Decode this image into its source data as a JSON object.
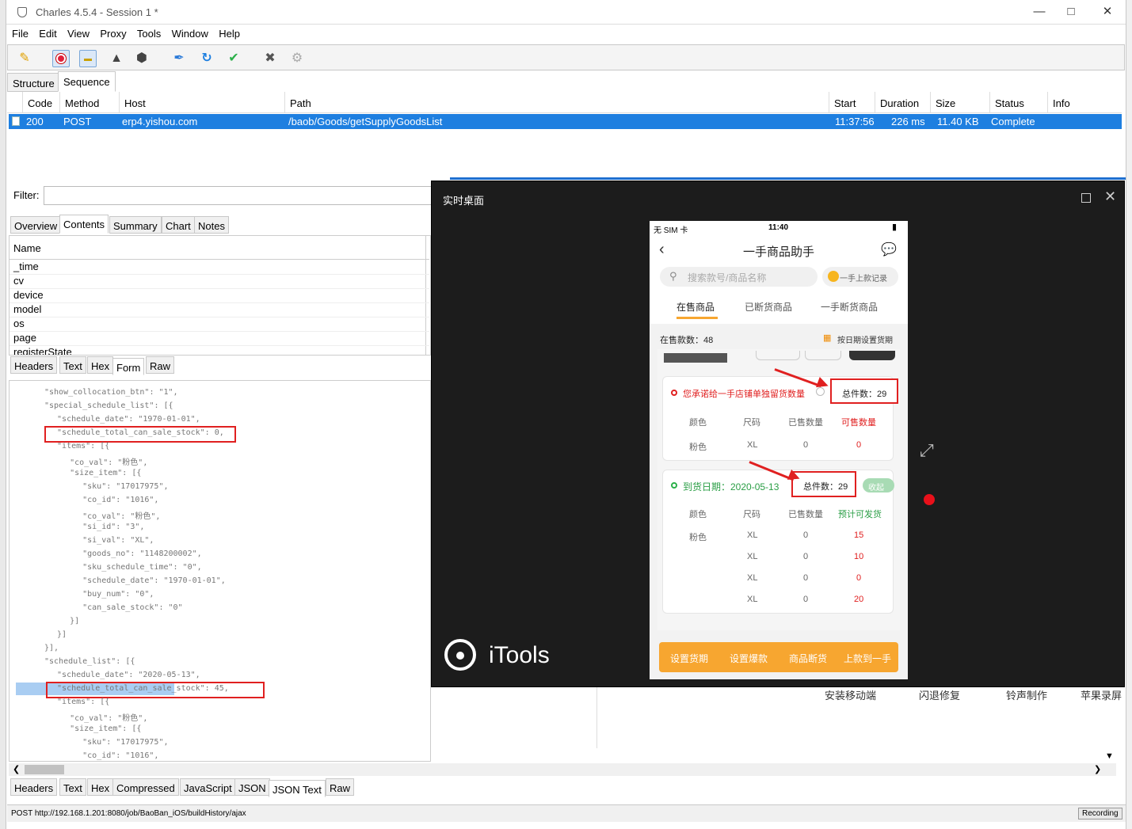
{
  "window": {
    "title": "Charles 4.5.4 - Session 1 *",
    "minimize": "—",
    "maximize": "□",
    "close": "✕"
  },
  "menu": [
    "File",
    "Edit",
    "View",
    "Proxy",
    "Tools",
    "Window",
    "Help"
  ],
  "toolbar": [
    "broom-icon",
    "record-icon",
    "throttle-icon",
    "turtle-icon",
    "stop-icon",
    "pen-icon",
    "refresh-icon",
    "check-icon",
    "tools-icon",
    "settings-icon"
  ],
  "tabs": {
    "structure": "Structure",
    "sequence": "Sequence"
  },
  "sequence": {
    "columns": [
      "Code",
      "Method",
      "Host",
      "Path",
      "Start",
      "Duration",
      "Size",
      "Status",
      "Info"
    ],
    "row": {
      "code": "200",
      "method": "POST",
      "host": "erp4.yishou.com",
      "path": "/baob/Goods/getSupplyGoodsList",
      "start": "11:37:56",
      "duration": "226 ms",
      "size": "11.40 KB",
      "status": "Complete",
      "info": ""
    }
  },
  "filter": {
    "label": "Filter:",
    "value": ""
  },
  "detail_tabs": [
    "Overview",
    "Contents",
    "Summary",
    "Chart",
    "Notes"
  ],
  "form": {
    "header": "Name",
    "rows": [
      "_time",
      "cv",
      "device",
      "model",
      "os",
      "page",
      "registerState"
    ]
  },
  "request_tabs": [
    "Headers",
    "Text",
    "Hex",
    "Form",
    "Raw"
  ],
  "json_lines": [
    "\"show_collocation_btn\": \"1\",",
    "\"special_schedule_list\": [{",
    "  \"schedule_date\": \"1970-01-01\",",
    "  \"schedule_total_can_sale_stock\": 0,",
    "  \"items\": [{",
    "    \"co_val\": \"粉色\",",
    "    \"size_item\": [{",
    "      \"sku\": \"17017975\",",
    "      \"co_id\": \"1016\",",
    "      \"co_val\": \"粉色\",",
    "      \"si_id\": \"3\",",
    "      \"si_val\": \"XL\",",
    "      \"goods_no\": \"1148200002\",",
    "      \"sku_schedule_time\": \"0\",",
    "      \"schedule_date\": \"1970-01-01\",",
    "      \"buy_num\": \"0\",",
    "      \"can_sale_stock\": \"0\"",
    "    }]",
    "  }]",
    "}],",
    "\"schedule_list\": [{",
    "  \"schedule_date\": \"2020-05-13\",",
    "  \"schedule_total_can_sale_stock\": 45,",
    "  \"items\": [{",
    "    \"co_val\": \"粉色\",",
    "    \"size_item\": [{",
    "      \"sku\": \"17017975\",",
    "      \"co_id\": \"1016\","
  ],
  "response_tabs": [
    "Headers",
    "Text",
    "Hex",
    "Compressed",
    "JavaScript",
    "JSON",
    "JSON Text",
    "Raw"
  ],
  "status_bar": {
    "text": "POST http://192.168.1.201:8080/job/BaoBan_iOS/buildHistory/ajax",
    "recording": "Recording"
  },
  "desktop_bg": [
    "安装移动端",
    "闪退修复",
    "铃声制作",
    "苹果录屏"
  ],
  "itools": {
    "title": "实时桌面",
    "brand": "iTools"
  },
  "phone": {
    "status_left": "无 SIM 卡",
    "time": "11:40",
    "nav_title": "一手商品助手",
    "search_placeholder": "搜索款号/商品名称",
    "record_btn": "一手上款记录",
    "tabs": [
      "在售商品",
      "已断货商品",
      "一手断货商品"
    ],
    "count_label": "在售款数：48",
    "schedule_link": "按日期设置货期",
    "card1": {
      "title": "您承诺给一手店铺单独留货数量",
      "total": "总件数：29",
      "headers": [
        "颜色",
        "尺码",
        "已售数量",
        "可售数量"
      ],
      "row": [
        "粉色",
        "XL",
        "0",
        "0"
      ]
    },
    "card2": {
      "title": "到货日期：2020-05-13",
      "total": "总件数：29",
      "collapse": "收起",
      "headers": [
        "颜色",
        "尺码",
        "已售数量",
        "预计可发货"
      ],
      "color": "粉色",
      "rows": [
        [
          "XL",
          "0",
          "15"
        ],
        [
          "XL",
          "0",
          "10"
        ],
        [
          "XL",
          "0",
          "0"
        ],
        [
          "XL",
          "0",
          "20"
        ]
      ]
    },
    "bottom_buttons": [
      "设置货期",
      "设置爆款",
      "商品断货",
      "上款到一手"
    ]
  },
  "colors": {
    "selection": "#1e7fe0",
    "accent_orange": "#f7a630",
    "highlight_red": "#e02020",
    "itools_bg": "#1c1c1c"
  }
}
